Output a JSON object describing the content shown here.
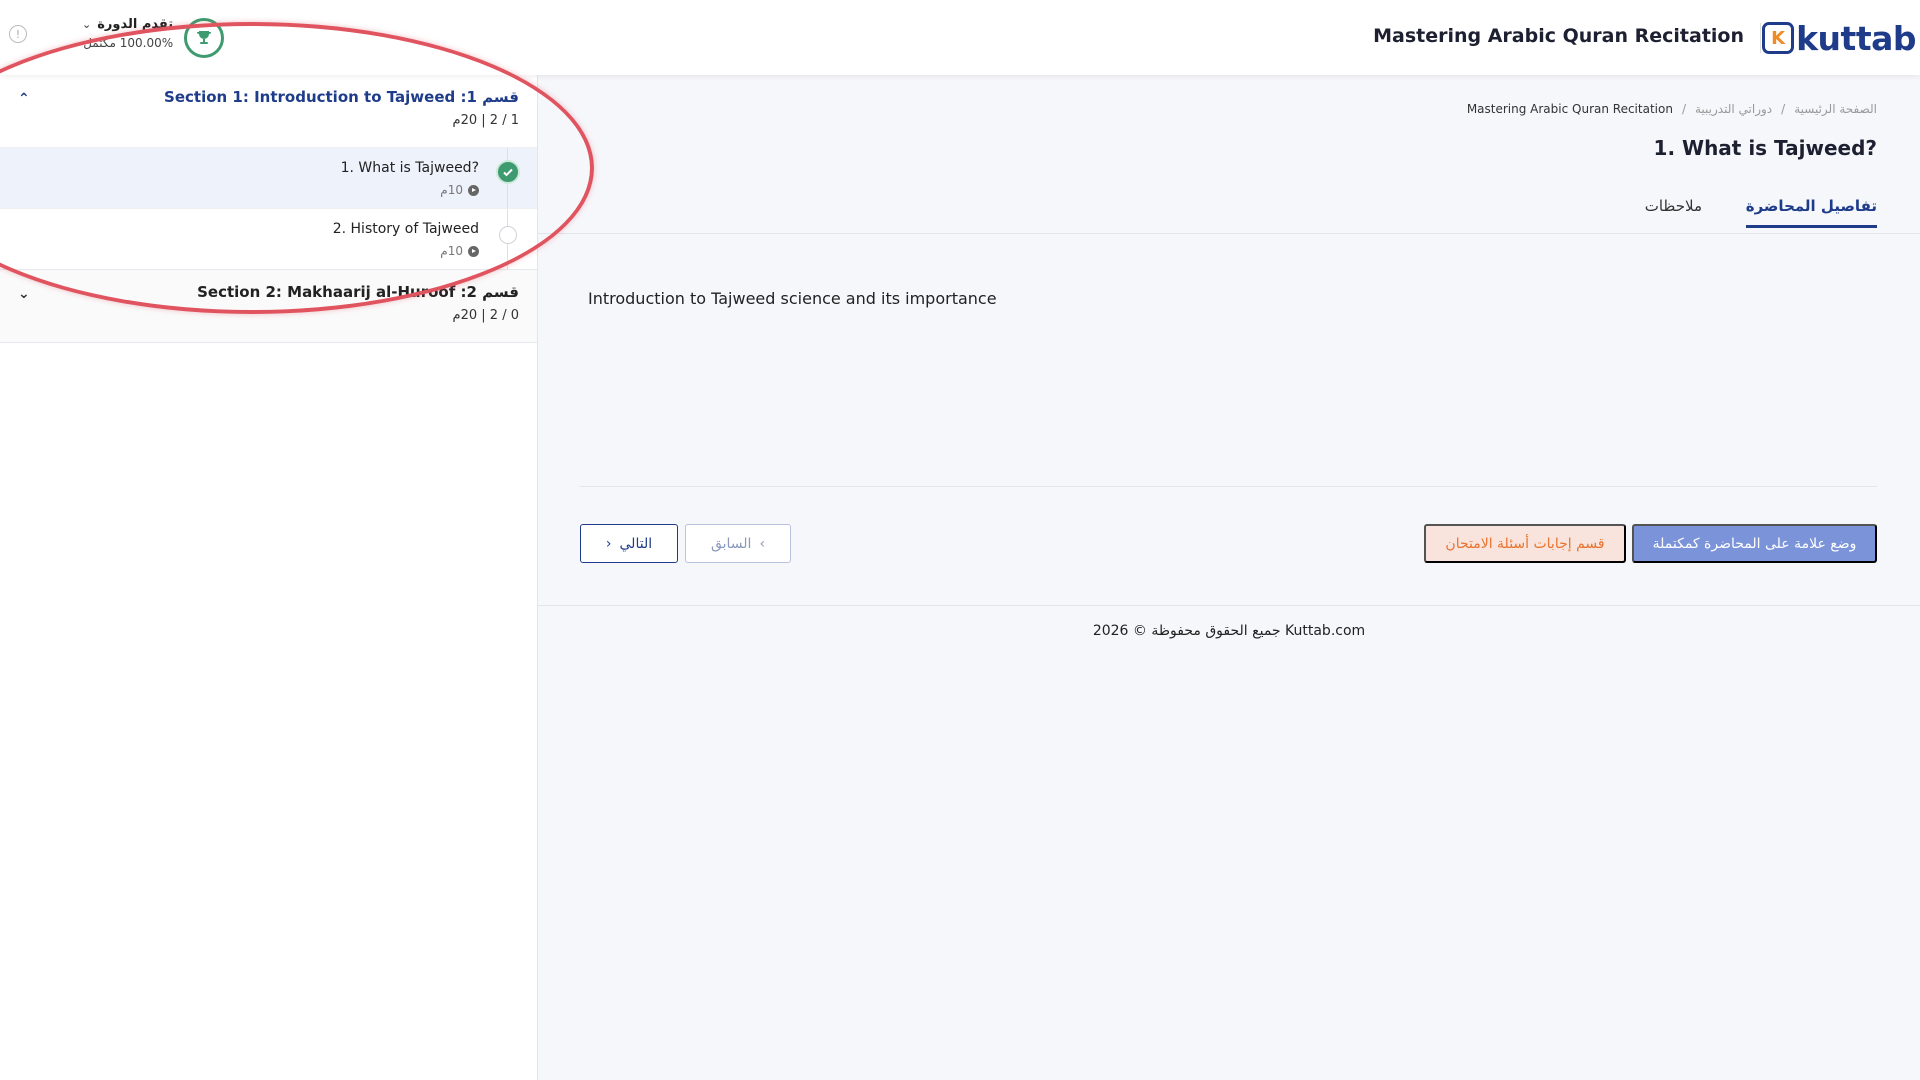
{
  "header": {
    "logo_text": "kuttab",
    "logo_mark": "K",
    "course_title": "Mastering Arabic Quran Recitation",
    "progress_label": "تقدم الدورة",
    "progress_percent": "100.00% مكتمل",
    "progress_value": 1.0,
    "icons": {
      "trophy": "trophy-icon",
      "info": "info-icon",
      "chevron": "chevron-down-icon"
    }
  },
  "sidebar": {
    "sections": [
      {
        "title": "قسم 1: Section 1: Introduction to Tajweed",
        "meta": "1 / 2 | 20م",
        "expanded": true,
        "lessons": [
          {
            "title": "1. What is Tajweed?",
            "duration": "10م",
            "completed": true,
            "active": true
          },
          {
            "title": "2. History of Tajweed",
            "duration": "10م",
            "completed": false,
            "active": false
          }
        ]
      },
      {
        "title": "قسم 2: Section 2: Makhaarij al-Huroof",
        "meta": "0 / 2 | 20م",
        "expanded": false,
        "lessons": []
      }
    ]
  },
  "main": {
    "breadcrumb": [
      "الصفحة الرئيسية",
      "/",
      "دوراتي التدريبية",
      "/",
      "Mastering Arabic Quran Recitation"
    ],
    "lecture_title": "1. What is Tajweed?",
    "tabs": [
      {
        "label": "تفاصيل المحاضرة",
        "active": true
      },
      {
        "label": "ملاحظات",
        "active": false
      }
    ],
    "description": "Introduction to Tajweed science and its importance",
    "buttons": {
      "complete": "وضع علامة على المحاضرة كمكتملة",
      "exam": "قسم إجابات أسئلة الامتحان",
      "previous": "السابق",
      "next": "التالي"
    },
    "footer": "جميع الحقوق محفوظة © 2026 Kuttab.com"
  },
  "colors": {
    "brand": "#1f3c8a",
    "success": "#3d9b6f",
    "accent_orange": "#e8732f",
    "annotation": "#e05460"
  }
}
